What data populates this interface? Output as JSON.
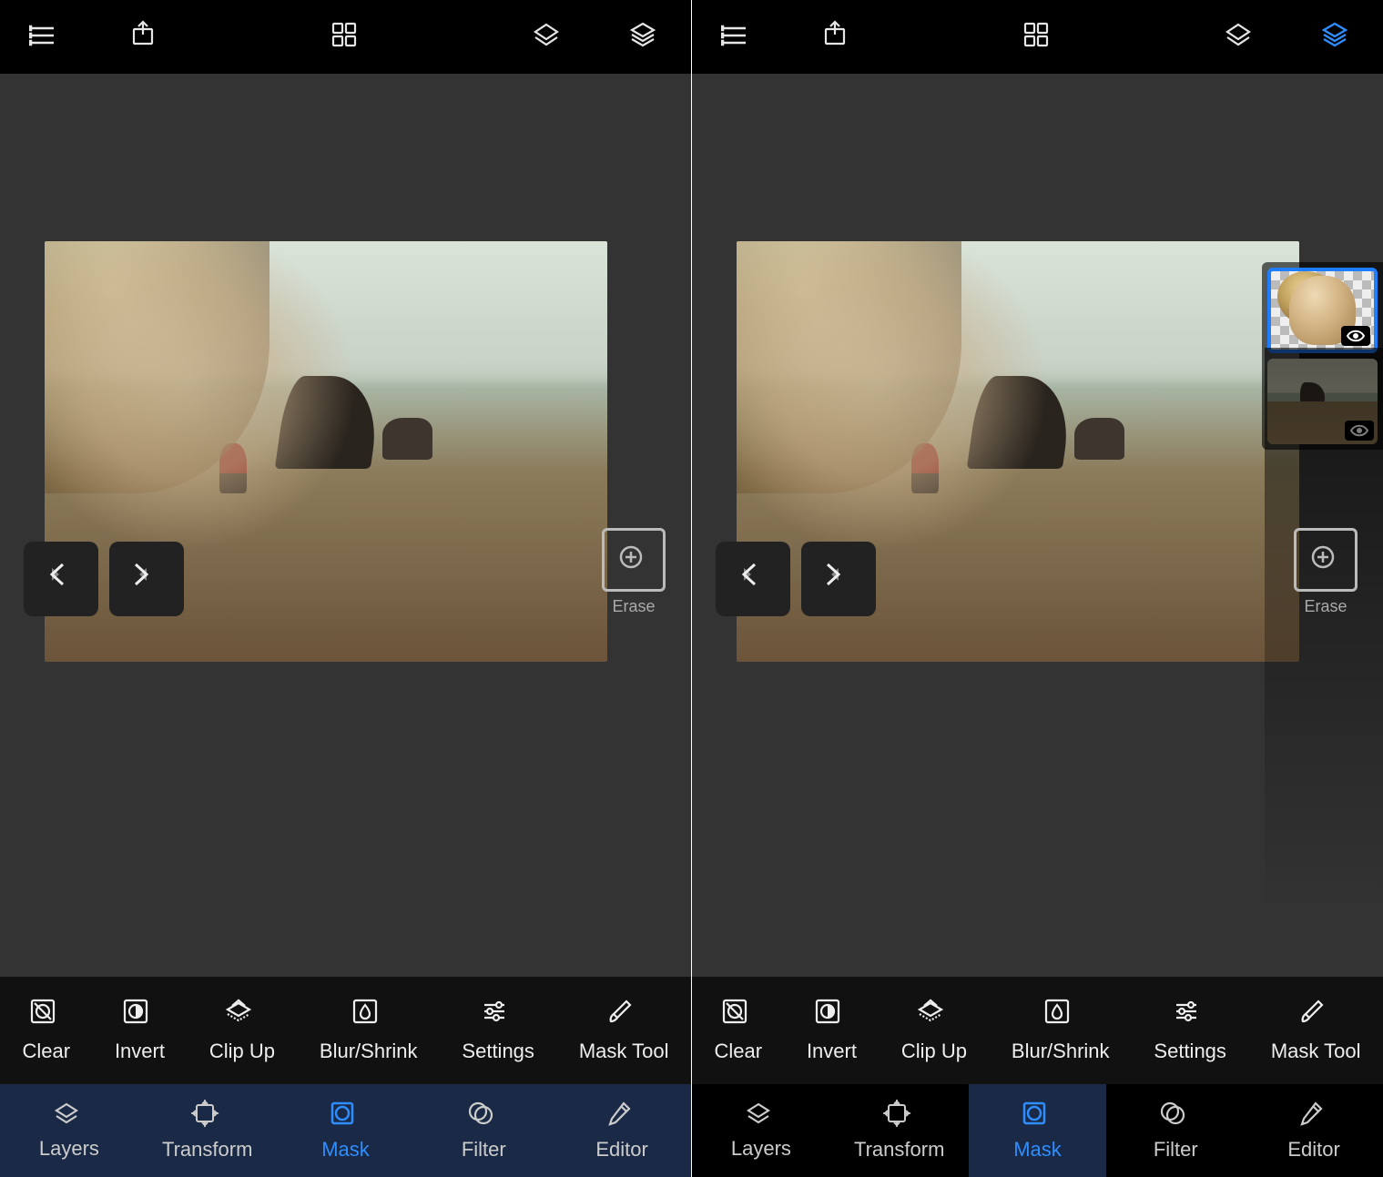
{
  "colors": {
    "accent": "#2e8dff",
    "bg": "#000000",
    "canvas": "#333333",
    "icon": "#e6e6e6"
  },
  "erase_label": "Erase",
  "tools": [
    {
      "id": "clear",
      "label": "Clear"
    },
    {
      "id": "invert",
      "label": "Invert"
    },
    {
      "id": "clipup",
      "label": "Clip Up"
    },
    {
      "id": "blurshrink",
      "label": "Blur/Shrink"
    },
    {
      "id": "settings",
      "label": "Settings"
    },
    {
      "id": "masktool",
      "label": "Mask Tool"
    }
  ],
  "nav": [
    {
      "id": "layers",
      "label": "Layers"
    },
    {
      "id": "transform",
      "label": "Transform"
    },
    {
      "id": "mask",
      "label": "Mask"
    },
    {
      "id": "filter",
      "label": "Filter"
    },
    {
      "id": "editor",
      "label": "Editor"
    }
  ],
  "panels": {
    "left": {
      "active_nav": "mask",
      "nav_style": "darkblue",
      "layers_panel_open": false,
      "layers_icon_active": false
    },
    "right": {
      "active_nav": "mask",
      "nav_style": "black_with_active_bg",
      "layers_panel_open": true,
      "layers_icon_active": true,
      "layer_thumbs": [
        {
          "id": "girl",
          "selected": true,
          "visible": true
        },
        {
          "id": "beach",
          "selected": false,
          "visible": true
        }
      ]
    }
  }
}
